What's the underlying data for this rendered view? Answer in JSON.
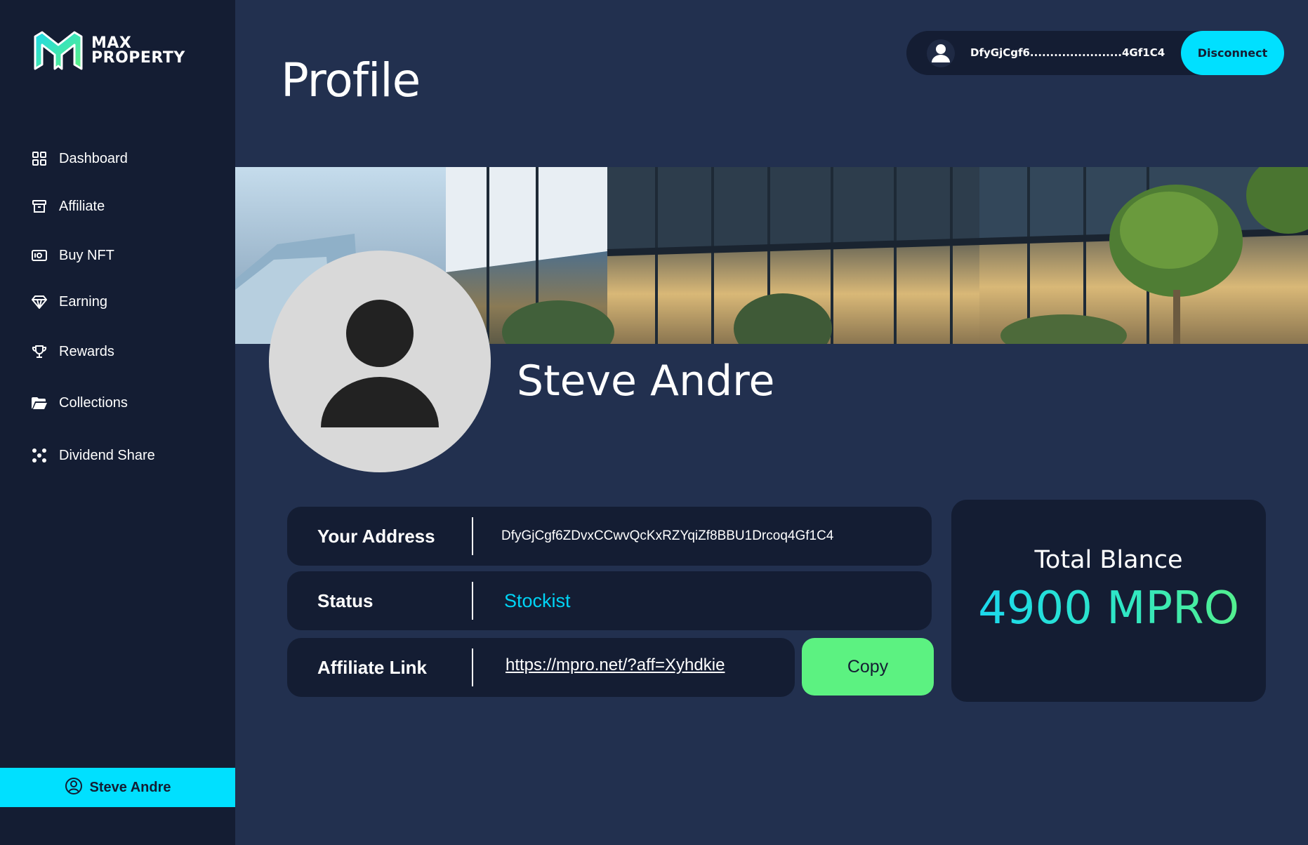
{
  "brand": {
    "line1": "MAX",
    "line2": "PROPERTY",
    "logo_icon": "m-logo-icon",
    "accent": "#00e0ff",
    "logo_gradient": [
      "#1fd8e8",
      "#5cf281"
    ]
  },
  "sidebar": {
    "items": [
      {
        "label": "Dashboard",
        "icon": "grid-icon"
      },
      {
        "label": "Affiliate",
        "icon": "box-icon"
      },
      {
        "label": "Buy NFT",
        "icon": "banknote-icon"
      },
      {
        "label": "Earning",
        "icon": "diamond-icon"
      },
      {
        "label": "Rewards",
        "icon": "trophy-icon"
      },
      {
        "label": "Collections",
        "icon": "folder-icon"
      },
      {
        "label": "Dividend Share",
        "icon": "network-icon"
      }
    ],
    "user": {
      "label": "Steve Andre",
      "icon": "user-circle-icon"
    }
  },
  "header": {
    "title": "Profile",
    "wallet_address": "DfyGjCgf6.......................4Gf1C4",
    "disconnect_label": "Disconnect"
  },
  "profile": {
    "name": "Steve Andre",
    "rows": {
      "address": {
        "key": "Your Address",
        "value": "DfyGjCgf6ZDvxCCwvQcKxRZYqiZf8BBU1Drcoq4Gf1C4"
      },
      "status": {
        "key": "Status",
        "value": "Stockist"
      },
      "affiliate": {
        "key": "Affiliate Link",
        "value": "https://mpro.net/?aff=Xyhdkie"
      }
    },
    "copy_label": "Copy"
  },
  "balance": {
    "label": "Total Blance",
    "value": "4900 MPRO"
  },
  "colors": {
    "background": "#22304f",
    "panel": "#141d33",
    "cyan": "#00e0ff",
    "green": "#5cf281"
  }
}
